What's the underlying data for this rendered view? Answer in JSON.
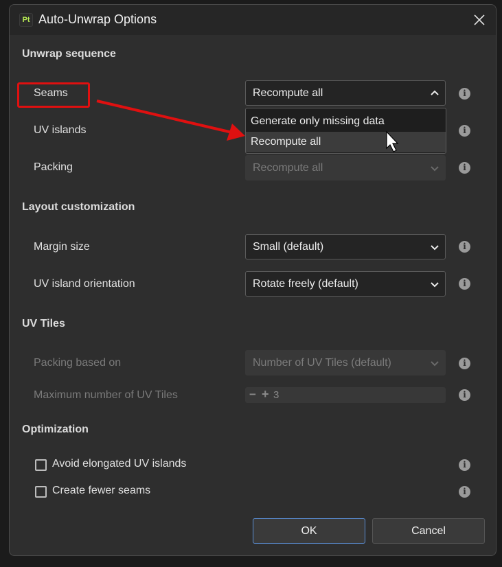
{
  "window": {
    "app_icon_text": "Pt",
    "title": "Auto-Unwrap Options",
    "close_icon": "close-icon"
  },
  "sections": {
    "unwrap_sequence": "Unwrap sequence",
    "layout_customization": "Layout customization",
    "uv_tiles": "UV Tiles",
    "optimization": "Optimization"
  },
  "unwrap": {
    "seams_label": "Seams",
    "seams_value": "Recompute all",
    "uv_islands_label": "UV islands",
    "packing_label": "Packing",
    "packing_value": "Recompute all"
  },
  "seams_menu": {
    "options": [
      "Generate only missing data",
      "Recompute all"
    ],
    "highlighted": "Recompute all"
  },
  "layout": {
    "margin_label": "Margin size",
    "margin_value": "Small (default)",
    "orientation_label": "UV island orientation",
    "orientation_value": "Rotate freely (default)"
  },
  "uv_tiles": {
    "packing_based_label": "Packing based on",
    "packing_based_value": "Number of UV Tiles (default)",
    "max_tiles_label": "Maximum number of UV Tiles",
    "max_tiles_value": "3",
    "minus_symbol": "−",
    "plus_symbol": "+"
  },
  "optimization": {
    "avoid_elongated_label": "Avoid elongated UV islands",
    "avoid_elongated_checked": false,
    "fewer_seams_label": "Create fewer seams",
    "fewer_seams_checked": false
  },
  "buttons": {
    "ok": "OK",
    "cancel": "Cancel"
  },
  "info_icon_text": "i",
  "colors": {
    "annotation_red": "#e01010",
    "ok_border": "#5b8fd6"
  }
}
